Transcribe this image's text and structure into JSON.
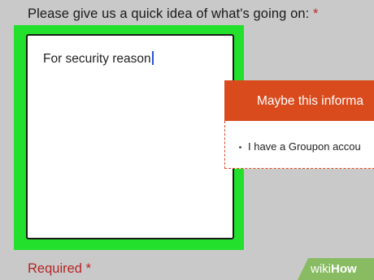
{
  "form": {
    "question_label": "Please give us a quick idea of what's going on:",
    "required_marker": "*",
    "textarea_value": "For security reason",
    "required_label": "Required",
    "required_marker_bottom": "*"
  },
  "suggestion_popup": {
    "header_text": "Maybe this informa",
    "item_text": "I have a Groupon accou"
  },
  "watermark": {
    "prefix": "wiki",
    "suffix": "How"
  },
  "colors": {
    "highlight": "#22e02c",
    "popup_header": "#d94a1c",
    "required_text": "#b52424",
    "caret": "#2a55d8"
  }
}
